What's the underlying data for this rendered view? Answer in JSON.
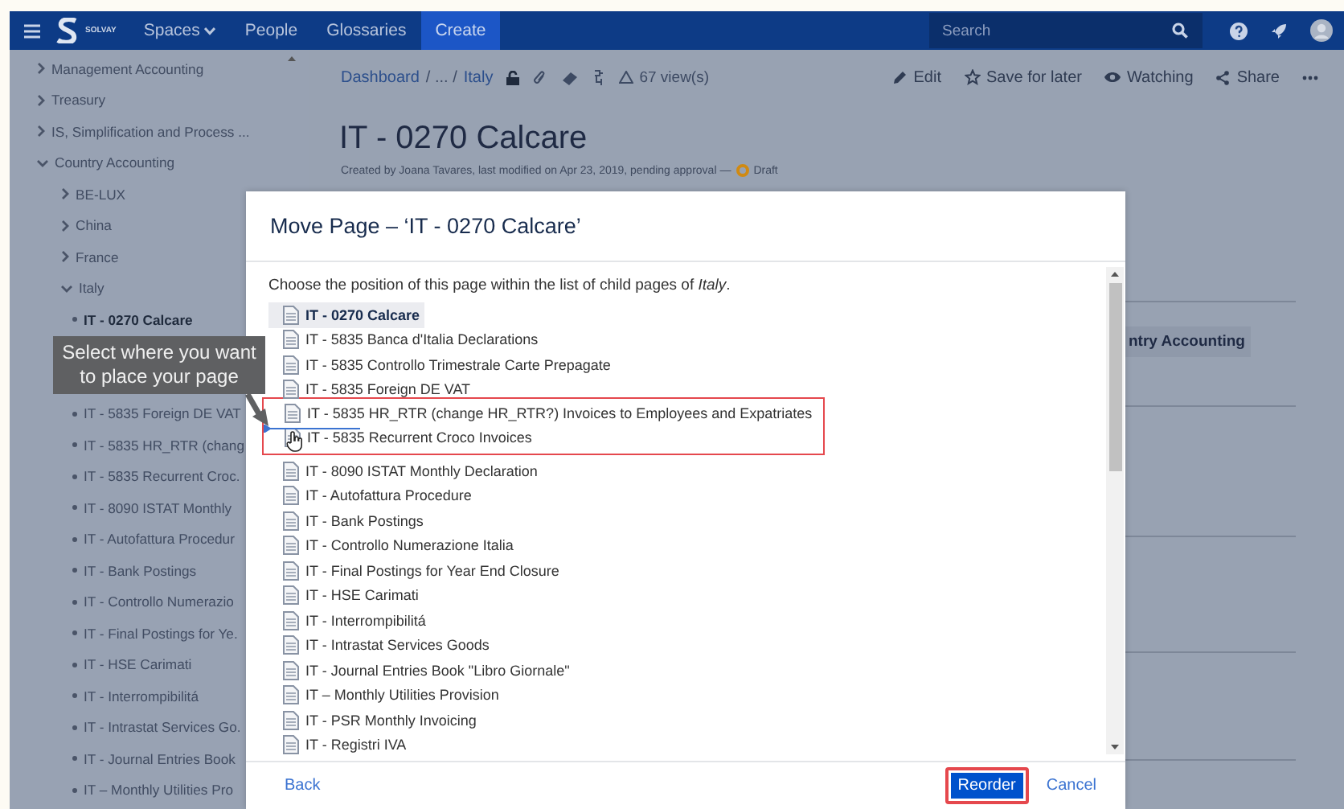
{
  "nav": {
    "logo_text": "SOLVAY",
    "items": [
      {
        "kind": "menu",
        "label": "Spaces",
        "dropdown": true
      },
      {
        "kind": "menu",
        "label": "People",
        "dropdown": false
      },
      {
        "kind": "menu",
        "label": "Glossaries",
        "dropdown": false
      },
      {
        "kind": "button",
        "label": "Create",
        "dropdown": false
      }
    ],
    "search": {
      "placeholder": "Search"
    }
  },
  "sidebar": {
    "items": [
      {
        "kind": "folder",
        "label": "Management Accounting",
        "expanded": false
      },
      {
        "kind": "folder",
        "label": "Treasury",
        "expanded": false
      },
      {
        "kind": "folder",
        "label": "IS, Simplification and Process ...",
        "expanded": false
      },
      {
        "kind": "folder",
        "label": "Country Accounting",
        "expanded": true,
        "children": [
          {
            "kind": "folder",
            "label": "BE-LUX",
            "expanded": false
          },
          {
            "kind": "folder",
            "label": "China",
            "expanded": false
          },
          {
            "kind": "folder",
            "label": "France",
            "expanded": false
          },
          {
            "kind": "folder",
            "label": "Italy",
            "expanded": true,
            "children": [
              {
                "kind": "page",
                "label": "IT - 0270 Calcare",
                "current": true
              },
              {
                "kind": "page",
                "label": "IT - 5835 Foreign DE VAT",
                "current": false
              },
              {
                "kind": "page",
                "label": "IT - 5835 HR_RTR (chang",
                "current": false
              },
              {
                "kind": "page",
                "label": "IT - 5835 Recurrent Croc.",
                "current": false
              },
              {
                "kind": "page",
                "label": "IT - 8090 ISTAT Monthly",
                "current": false
              },
              {
                "kind": "page",
                "label": "IT - Autofattura Procedur",
                "current": false
              },
              {
                "kind": "page",
                "label": "IT - Bank Postings",
                "current": false
              },
              {
                "kind": "page",
                "label": "IT - Controllo Numerazio",
                "current": false
              },
              {
                "kind": "page",
                "label": "IT - Final Postings for Ye.",
                "current": false
              },
              {
                "kind": "page",
                "label": "IT - HSE Carimati",
                "current": false
              },
              {
                "kind": "page",
                "label": "IT - Interrompibilitá",
                "current": false
              },
              {
                "kind": "page",
                "label": "IT - Intrastat Services Go.",
                "current": false
              },
              {
                "kind": "page",
                "label": "IT - Journal Entries Book",
                "current": false
              },
              {
                "kind": "page",
                "label": "IT – Monthly Utilities Pro",
                "current": false
              }
            ]
          }
        ]
      }
    ],
    "tooltip": {
      "text": "Select where you want to place your page"
    }
  },
  "page": {
    "breadcrumb": [
      {
        "kind": "link",
        "label": "Dashboard"
      },
      {
        "kind": "separator",
        "label": "/ ... /"
      },
      {
        "kind": "link",
        "label": "Italy"
      }
    ],
    "views": "67 view(s)",
    "actions": [
      {
        "kind": "edit",
        "label": "Edit"
      },
      {
        "kind": "save",
        "label": "Save for later"
      },
      {
        "kind": "watch",
        "label": "Watching"
      },
      {
        "kind": "share",
        "label": "Share"
      }
    ],
    "title": "IT - 0270 Calcare",
    "meta": "Created by Joana Tavares, last modified on Apr 23, 2019, pending approval —",
    "status": "Draft",
    "side_tag": "ntry Accounting"
  },
  "dialog": {
    "title": "Move Page – ‘IT - 0270 Calcare’",
    "description": "Choose the position of this page within the list of child pages of *Italy*.",
    "rows": [
      {
        "title": "IT - 0270 Calcare",
        "selected": true,
        "highlighted": false,
        "drop_target": false
      },
      {
        "title": "IT - 5835 Banca d'Italia Declarations",
        "selected": false,
        "highlighted": false,
        "drop_target": false
      },
      {
        "title": "IT - 5835 Controllo Trimestrale Carte Prepagate",
        "selected": false,
        "highlighted": false,
        "drop_target": false
      },
      {
        "title": "IT - 5835 Foreign DE VAT",
        "selected": false,
        "highlighted": false,
        "drop_target": false
      },
      {
        "title": "IT - 5835 HR_RTR (change HR_RTR?) Invoices to Employees and Expatriates",
        "selected": false,
        "highlighted": true,
        "drop_target": false
      },
      {
        "title": "IT - 5835 Recurrent Croco Invoices",
        "selected": false,
        "highlighted": true,
        "drop_target": true
      },
      {
        "title": "IT - 8090 ISTAT Monthly Declaration",
        "selected": false,
        "highlighted": false,
        "drop_target": false
      },
      {
        "title": "IT - Autofattura Procedure",
        "selected": false,
        "highlighted": false,
        "drop_target": false
      },
      {
        "title": "IT - Bank Postings",
        "selected": false,
        "highlighted": false,
        "drop_target": false
      },
      {
        "title": "IT - Controllo Numerazione Italia",
        "selected": false,
        "highlighted": false,
        "drop_target": false
      },
      {
        "title": "IT - Final Postings for Year End Closure",
        "selected": false,
        "highlighted": false,
        "drop_target": false
      },
      {
        "title": "IT - HSE Carimati",
        "selected": false,
        "highlighted": false,
        "drop_target": false
      },
      {
        "title": "IT - Interrompibilitá",
        "selected": false,
        "highlighted": false,
        "drop_target": false
      },
      {
        "title": "IT - Intrastat Services Goods",
        "selected": false,
        "highlighted": false,
        "drop_target": false
      },
      {
        "title": "IT - Journal Entries Book \"Libro Giornale\"",
        "selected": false,
        "highlighted": false,
        "drop_target": false
      },
      {
        "title": "IT – Monthly Utilities Provision",
        "selected": false,
        "highlighted": false,
        "drop_target": false
      },
      {
        "title": "IT - PSR Monthly Invoicing",
        "selected": false,
        "highlighted": false,
        "drop_target": false
      },
      {
        "title": "IT - Registri IVA",
        "selected": false,
        "highlighted": false,
        "drop_target": false
      }
    ],
    "back": "Back",
    "buttons": [
      {
        "kind": "primary",
        "label": "Reorder",
        "highlighted": true
      },
      {
        "kind": "link",
        "label": "Cancel",
        "highlighted": false
      }
    ]
  }
}
